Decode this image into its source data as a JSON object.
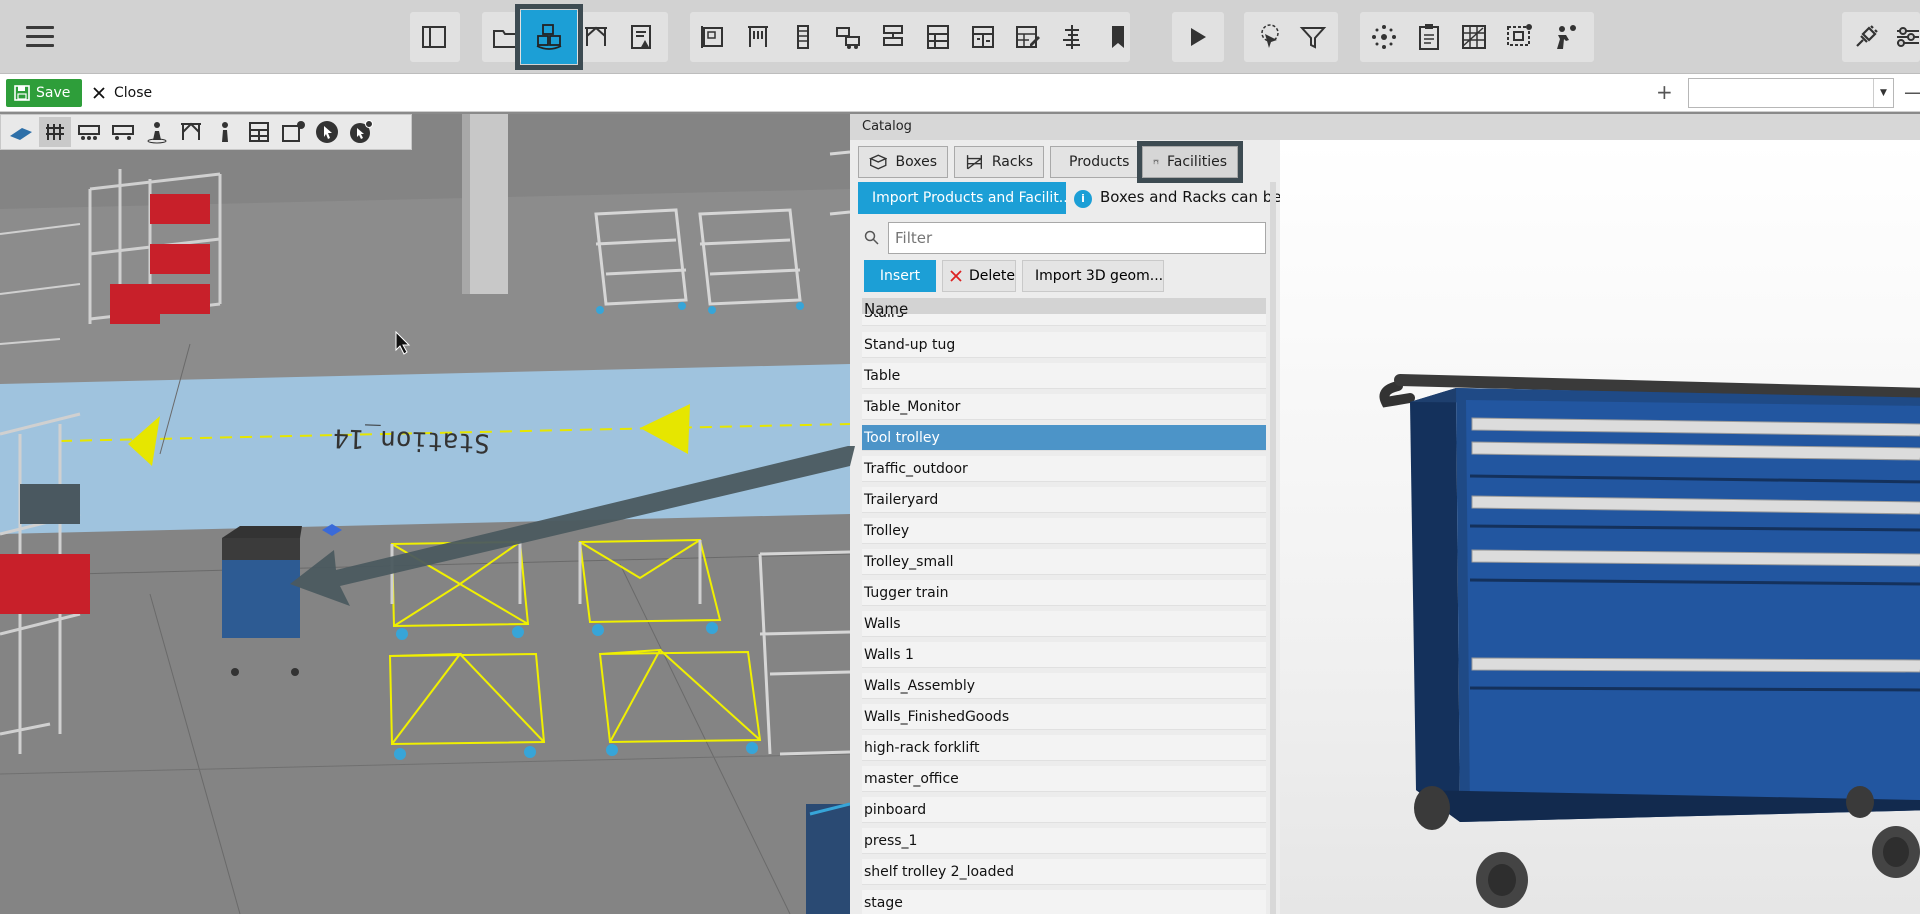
{
  "actionbar": {
    "save_label": "Save",
    "close_label": "Close",
    "combo_value": ""
  },
  "catalog": {
    "header": "Catalog",
    "tabs": [
      {
        "label": "Boxes"
      },
      {
        "label": "Racks"
      },
      {
        "label": "Products"
      },
      {
        "label": "Facilities"
      }
    ],
    "active_tab": "Facilities",
    "import_label": "Import Products and Facilit...",
    "info_text": "Boxes and Racks can be i",
    "filter_placeholder": "Filter",
    "insert_label": "Insert",
    "delete_label": "Delete",
    "import3d_label": "Import 3D geom...",
    "column_name": "Name",
    "items": [
      "Stairs",
      "Stand-up tug",
      "Table",
      "Table_Monitor",
      "Tool trolley",
      "Traffic_outdoor",
      "Traileryard",
      "Trolley",
      "Trolley_small",
      "Tugger train",
      "Walls",
      "Walls 1",
      "Walls_Assembly",
      "Walls_FinishedGoods",
      "high-rack forklift",
      "master_office",
      "pinboard",
      "press_1",
      "shelf trolley 2_loaded",
      "stage"
    ],
    "selected_item": "Tool trolley"
  },
  "viewport": {
    "floor_label": "Station_14"
  },
  "colors": {
    "accent": "#1c9fd6",
    "save": "#2e9e3a",
    "selected_row": "#4c94c8",
    "highlight_outline": "#3d4b52"
  }
}
